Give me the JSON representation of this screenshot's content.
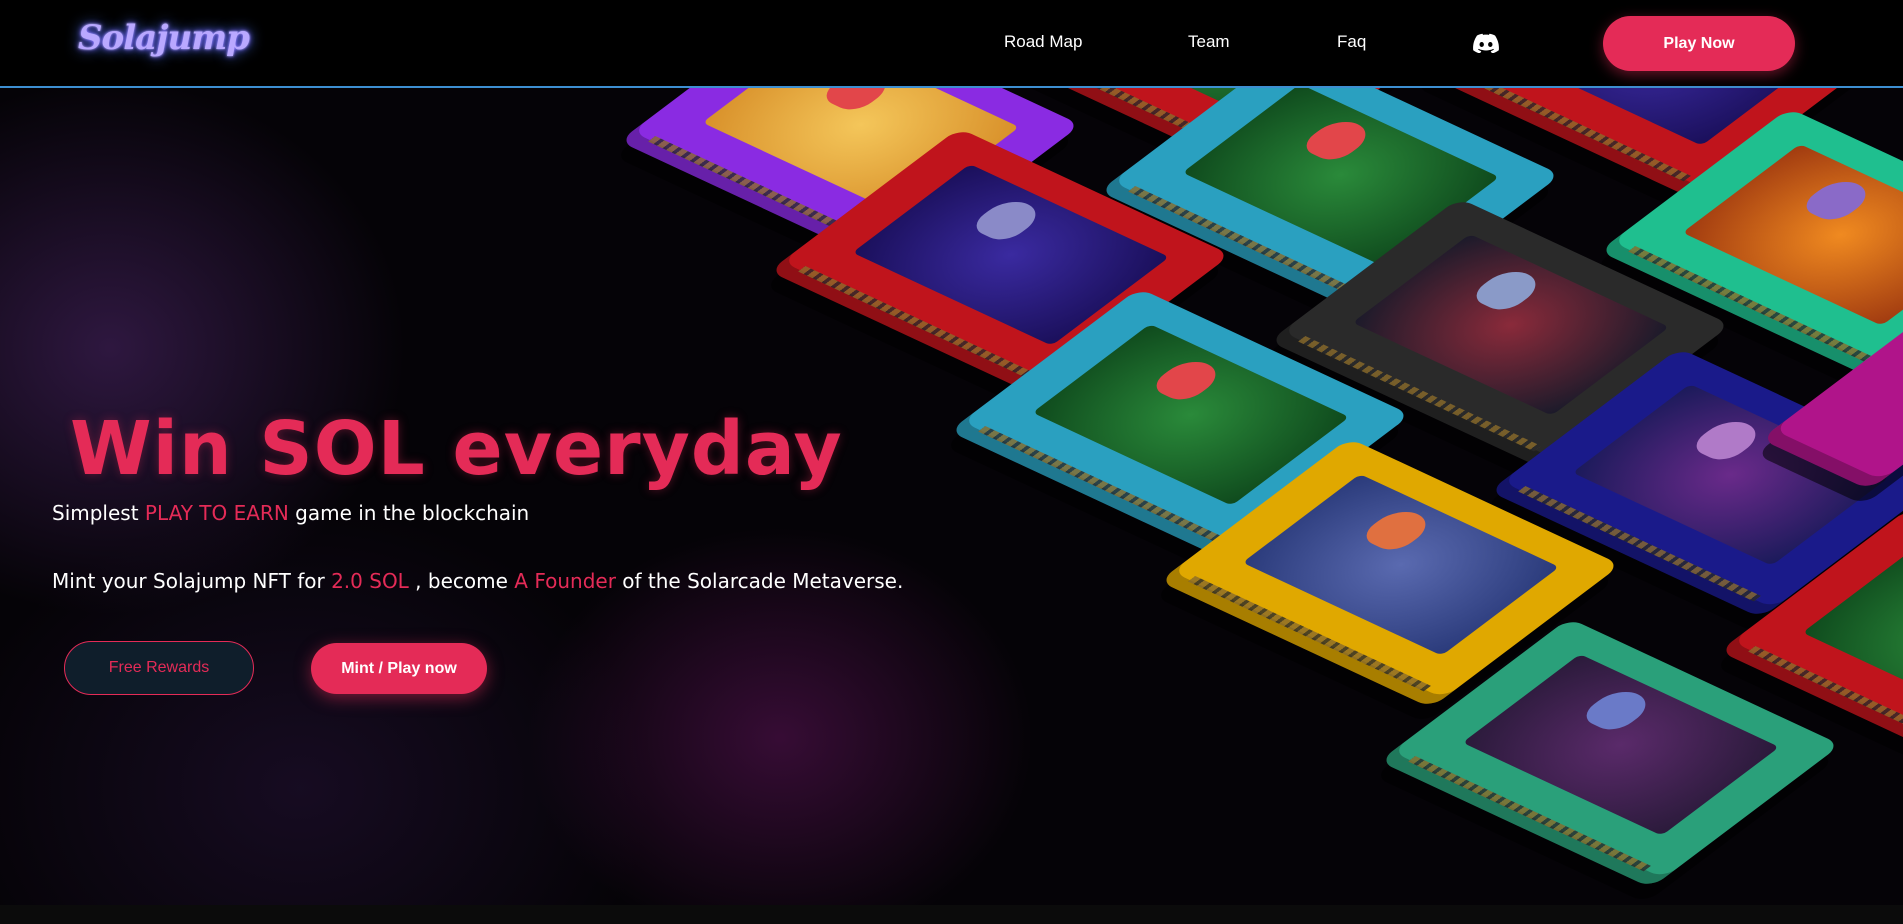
{
  "header": {
    "logo_text": "Solajump",
    "nav": [
      {
        "label": "Road Map"
      },
      {
        "label": "Team"
      },
      {
        "label": "Faq"
      }
    ],
    "discord_icon": "discord-icon",
    "play_now_label": "Play Now"
  },
  "hero": {
    "title": "Win SOL everyday",
    "tagline": {
      "before": "Simplest ",
      "accent": "PLAY TO EARN",
      "after": " game in the blockchain"
    },
    "mint_line": {
      "part1": "Mint your Solajump NFT for ",
      "price": "2.0 SOL",
      "part2": " , become ",
      "role": "A Founder",
      "part3": " of the Solarcade Metaverse."
    },
    "free_rewards_label": "Free Rewards",
    "mint_play_label": "Mint / Play now"
  },
  "colors": {
    "accent": "#e42b57",
    "header_border": "#3d8fd1",
    "background": "#000000",
    "cartridge_colors": [
      "#8a2be2",
      "#c0141c",
      "#2aa0c0",
      "#1fbf8f",
      "#2a2a2a",
      "#1a1a8a",
      "#e0a800",
      "#2aa07a"
    ]
  }
}
